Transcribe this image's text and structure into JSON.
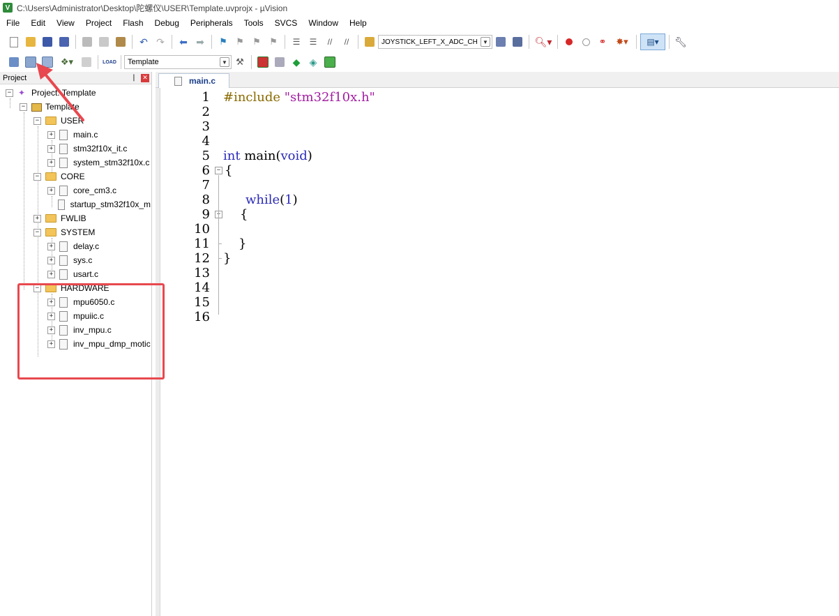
{
  "titlebar": {
    "title": "C:\\Users\\Administrator\\Desktop\\陀螺仪\\USER\\Template.uvprojx - µVision",
    "app_icon_letter": "V"
  },
  "menubar": {
    "items": [
      "File",
      "Edit",
      "View",
      "Project",
      "Flash",
      "Debug",
      "Peripherals",
      "Tools",
      "SVCS",
      "Window",
      "Help"
    ]
  },
  "toolbar1": {
    "target_dropdown": "JOYSTICK_LEFT_X_ADC_CH"
  },
  "toolbar2": {
    "target_select": "Template",
    "load_label": "LOAD"
  },
  "project_panel": {
    "title": "Project",
    "pin_glyph": "❘",
    "close_glyph": "✕",
    "root": "Project: Template",
    "target": "Template",
    "groups": [
      {
        "name": "USER",
        "files": [
          "main.c",
          "stm32f10x_it.c",
          "system_stm32f10x.c"
        ]
      },
      {
        "name": "CORE",
        "files": [
          "core_cm3.c",
          "startup_stm32f10x_m"
        ]
      },
      {
        "name": "FWLIB",
        "files": []
      },
      {
        "name": "SYSTEM",
        "files": [
          "delay.c",
          "sys.c",
          "usart.c"
        ]
      },
      {
        "name": "HARDWARE",
        "files": [
          "mpu6050.c",
          "mpuiic.c",
          "inv_mpu.c",
          "inv_mpu_dmp_motic"
        ]
      }
    ]
  },
  "editor": {
    "active_tab": "main.c",
    "line_numbers": [
      "1",
      "2",
      "3",
      "4",
      "5",
      "6",
      "7",
      "8",
      "9",
      "10",
      "11",
      "12",
      "13",
      "14",
      "15",
      "16"
    ],
    "code": {
      "l1_directive": "#include",
      "l1_string": "\"stm32f10x.h\"",
      "l5_type": "int",
      "l5_name": " main(",
      "l5_param": "void",
      "l5_close": ")",
      "l6": "{",
      "l8_kw": "while",
      "l8_open": "(",
      "l8_num": "1",
      "l8_close": ")",
      "l9": "{",
      "l11": "}",
      "l12": "}"
    }
  },
  "colors": {
    "annotation": "#e8484f",
    "keyword": "#2a2ab8",
    "string": "#a11ca1",
    "preprocessor": "#8a6a00"
  }
}
